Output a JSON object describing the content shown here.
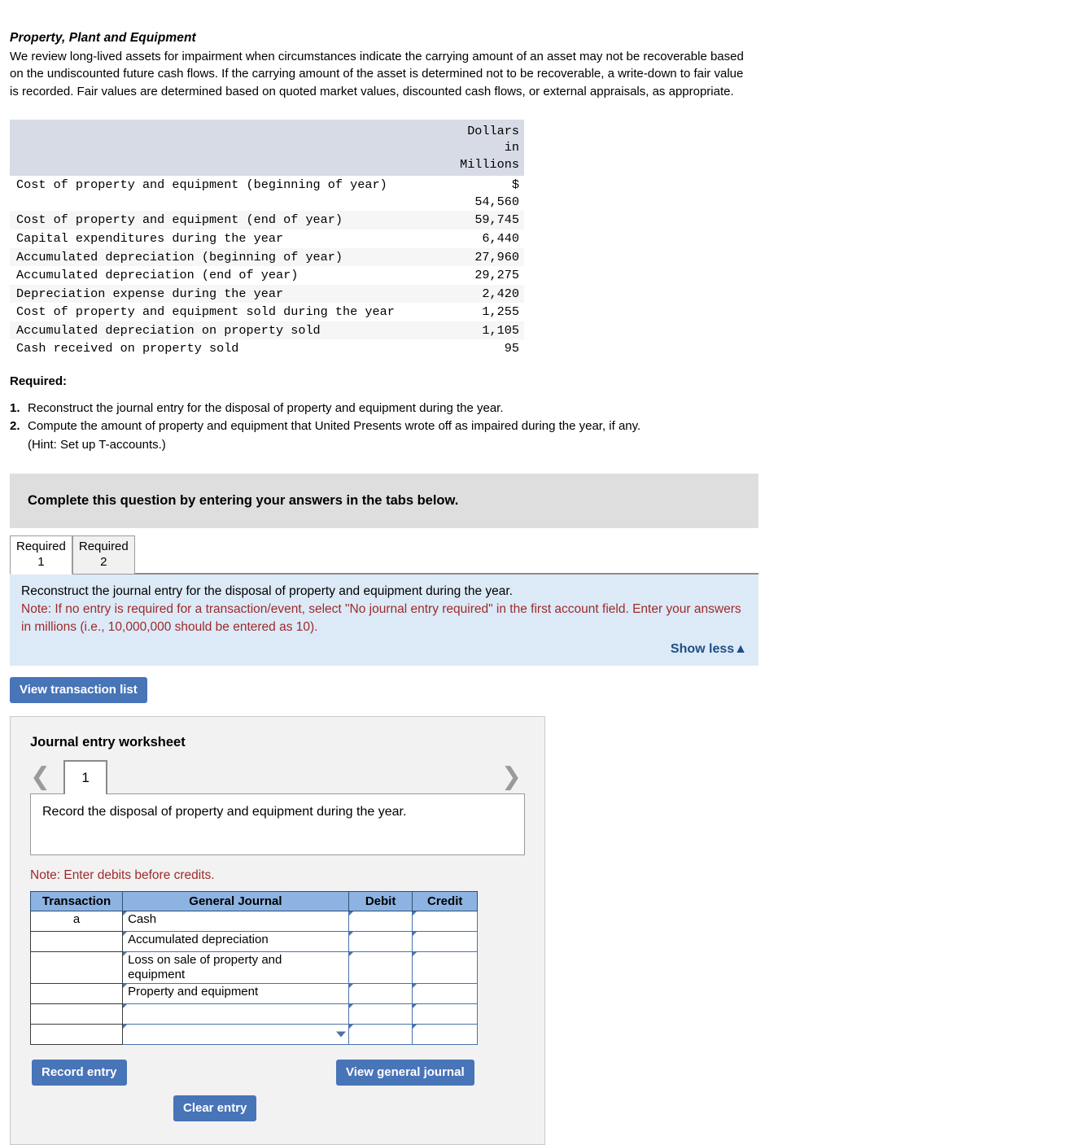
{
  "intro": {
    "heading": "Property, Plant and Equipment",
    "body": "We review long-lived assets for impairment when circumstances indicate the carrying amount of an asset may not be recoverable based on the undiscounted future cash flows. If the carrying amount of the asset is determined not to be recoverable, a write-down to fair value is recorded. Fair values are determined based on quoted market values, discounted cash flows, or external appraisals, as appropriate."
  },
  "fin_table": {
    "units_header": "Dollars\nin\nMillions",
    "rows": [
      {
        "label": "Cost of property and equipment (beginning of year)",
        "value": "$\n54,560"
      },
      {
        "label": "Cost of property and equipment (end of year)",
        "value": "59,745"
      },
      {
        "label": "Capital expenditures during the year",
        "value": "6,440"
      },
      {
        "label": "Accumulated depreciation (beginning of year)",
        "value": "27,960"
      },
      {
        "label": "Accumulated depreciation (end of year)",
        "value": "29,275"
      },
      {
        "label": "Depreciation expense during the year",
        "value": "2,420"
      },
      {
        "label": "Cost of property and equipment sold during the year",
        "value": "1,255"
      },
      {
        "label": "Accumulated depreciation on property sold",
        "value": "1,105"
      },
      {
        "label": "Cash received on property sold",
        "value": "95"
      }
    ]
  },
  "required": {
    "heading": "Required:",
    "items": [
      {
        "num": "1.",
        "text": "Reconstruct the journal entry for the disposal of property and equipment during the year."
      },
      {
        "num": "2.",
        "text": "Compute the amount of property and equipment that United Presents wrote off as impaired during the year, if any."
      }
    ],
    "hint": "(Hint: Set up T-accounts.)"
  },
  "complete_bar": {
    "text": "Complete this question by entering your answers in the tabs below."
  },
  "tabs": [
    {
      "label": "Required\n1",
      "line1": "Required",
      "line2": "1",
      "active": true
    },
    {
      "label": "Required\n2",
      "line1": "Required",
      "line2": "2",
      "active": false
    }
  ],
  "instruction_panel": {
    "line_black": "Reconstruct the journal entry for the disposal of property and equipment during the year.",
    "line_red": "Note: If no entry is required for a transaction/event, select \"No journal entry required\" in the first account field. Enter your answers in millions (i.e., 10,000,000 should be entered as 10).",
    "show_less": "Show less▲"
  },
  "buttons": {
    "view_transaction_list": "View transaction list",
    "record_entry": "Record entry",
    "clear_entry": "Clear entry",
    "view_general_journal": "View general journal"
  },
  "worksheet": {
    "title": "Journal entry worksheet",
    "page_number": "1",
    "prev_icon": "chevron-left",
    "next_icon": "chevron-right",
    "description": "Record the disposal of property and equipment during the year.",
    "note": "Note: Enter debits before credits.",
    "columns": [
      "Transaction",
      "General Journal",
      "Debit",
      "Credit"
    ],
    "rows": [
      {
        "transaction": "a",
        "account": "Cash",
        "debit": "",
        "credit": ""
      },
      {
        "transaction": "",
        "account": "Accumulated depreciation",
        "debit": "",
        "credit": ""
      },
      {
        "transaction": "",
        "account": "Loss on sale of property and equipment",
        "debit": "",
        "credit": ""
      },
      {
        "transaction": "",
        "account": "Property and equipment",
        "debit": "",
        "credit": ""
      },
      {
        "transaction": "",
        "account": "",
        "debit": "",
        "credit": ""
      },
      {
        "transaction": "",
        "account": "",
        "debit": "",
        "credit": "",
        "dropdown": true
      }
    ]
  },
  "colors": {
    "accent_blue": "#4874b8",
    "panel_blue": "#dceaf7",
    "note_red": "#9e2a2a",
    "table_header_blue": "#8db3e2",
    "fin_header_gray": "#d7dbe5",
    "complete_bar_gray": "#dedede"
  }
}
